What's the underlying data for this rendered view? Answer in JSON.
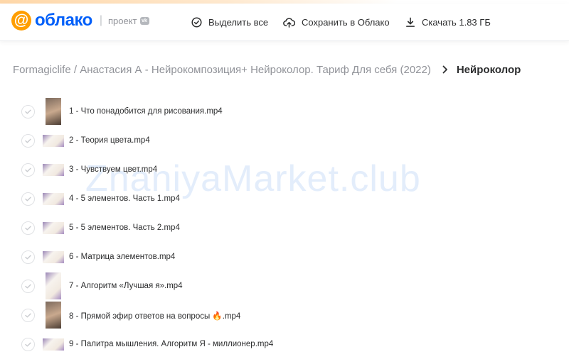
{
  "header": {
    "logo_text": "облако",
    "project_label": "проект",
    "vk_badge": "vk",
    "select_all": "Выделить все",
    "save_to_cloud": "Сохранить в Облако",
    "download": "Скачать 1.83 ГБ"
  },
  "breadcrumb": {
    "path": "Formagiclife / Анастасия А - Нейрокомпозиция+ Нейроколор. Тариф Для себя (2022)",
    "current": "Нейроколор"
  },
  "watermark": "ZnaniyaMarket.club",
  "files": [
    {
      "name": "1 - Что понадобится для рисования.mp4"
    },
    {
      "name": "2 - Теория цвета.mp4"
    },
    {
      "name": "3 - Чувствуем цвет.mp4"
    },
    {
      "name": "4 - 5 элементов. Часть 1.mp4"
    },
    {
      "name": "5 - 5 элементов. Часть 2.mp4"
    },
    {
      "name": "6 - Матрица элементов.mp4"
    },
    {
      "name": "7 - Алгоритм «Лучшая я».mp4"
    },
    {
      "name": "8 - Прямой эфир ответов на вопросы 🔥.mp4"
    },
    {
      "name": "9 - Палитра мышления. Алгоритм Я - миллионер.mp4"
    }
  ],
  "colors": {
    "brand_blue": "#005ff9",
    "brand_orange": "#ff9e00"
  }
}
